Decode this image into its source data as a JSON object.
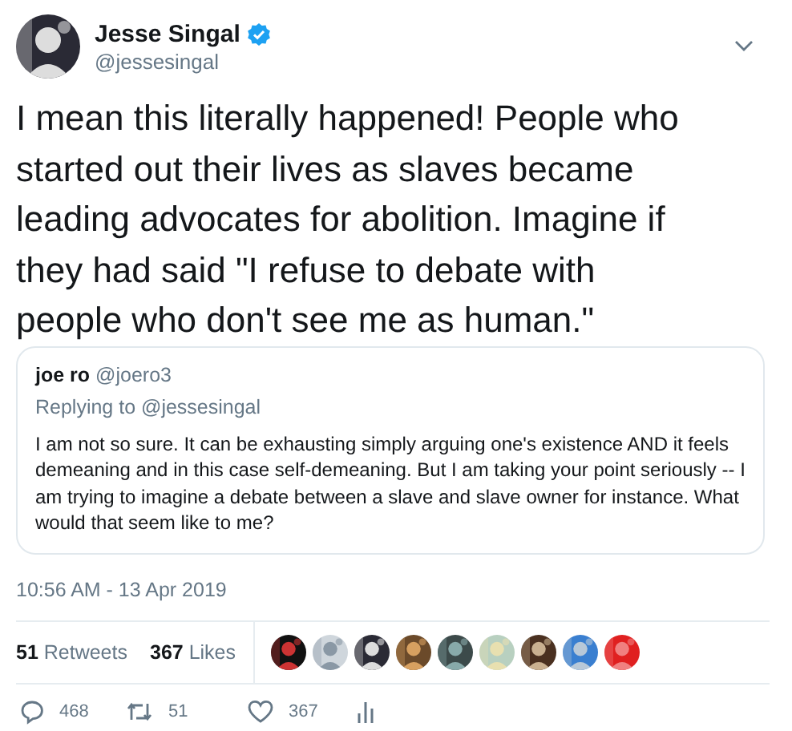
{
  "author": {
    "name": "Jesse Singal",
    "verified": true,
    "handle": "@jessesingal"
  },
  "text": "I mean this literally happened! People who started out their lives as slaves became leading advocates for abolition. Imagine if they had said \"I refuse to debate with people who don't see me as human.\"",
  "quoted": {
    "name": "joe ro",
    "handle": "@joero3",
    "replying_to": "Replying to @jessesingal",
    "text": "I am not so sure. It can be exhausting simply arguing one's existence AND it feels demeaning and in this case self-demeaning. But I am taking your point seriously -- I am trying to imagine a debate between a slave and slave owner for instance. What would that seem like to me?"
  },
  "timestamp": "10:56 AM - 13 Apr 2019",
  "stats": [
    {
      "count": "51",
      "label": "Retweets"
    },
    {
      "count": "367",
      "label": "Likes"
    }
  ],
  "actions": [
    {
      "kind": "reply",
      "count": "468"
    },
    {
      "kind": "retweet",
      "count": "51"
    },
    {
      "kind": "like",
      "count": "367"
    },
    {
      "kind": "analytics"
    }
  ]
}
